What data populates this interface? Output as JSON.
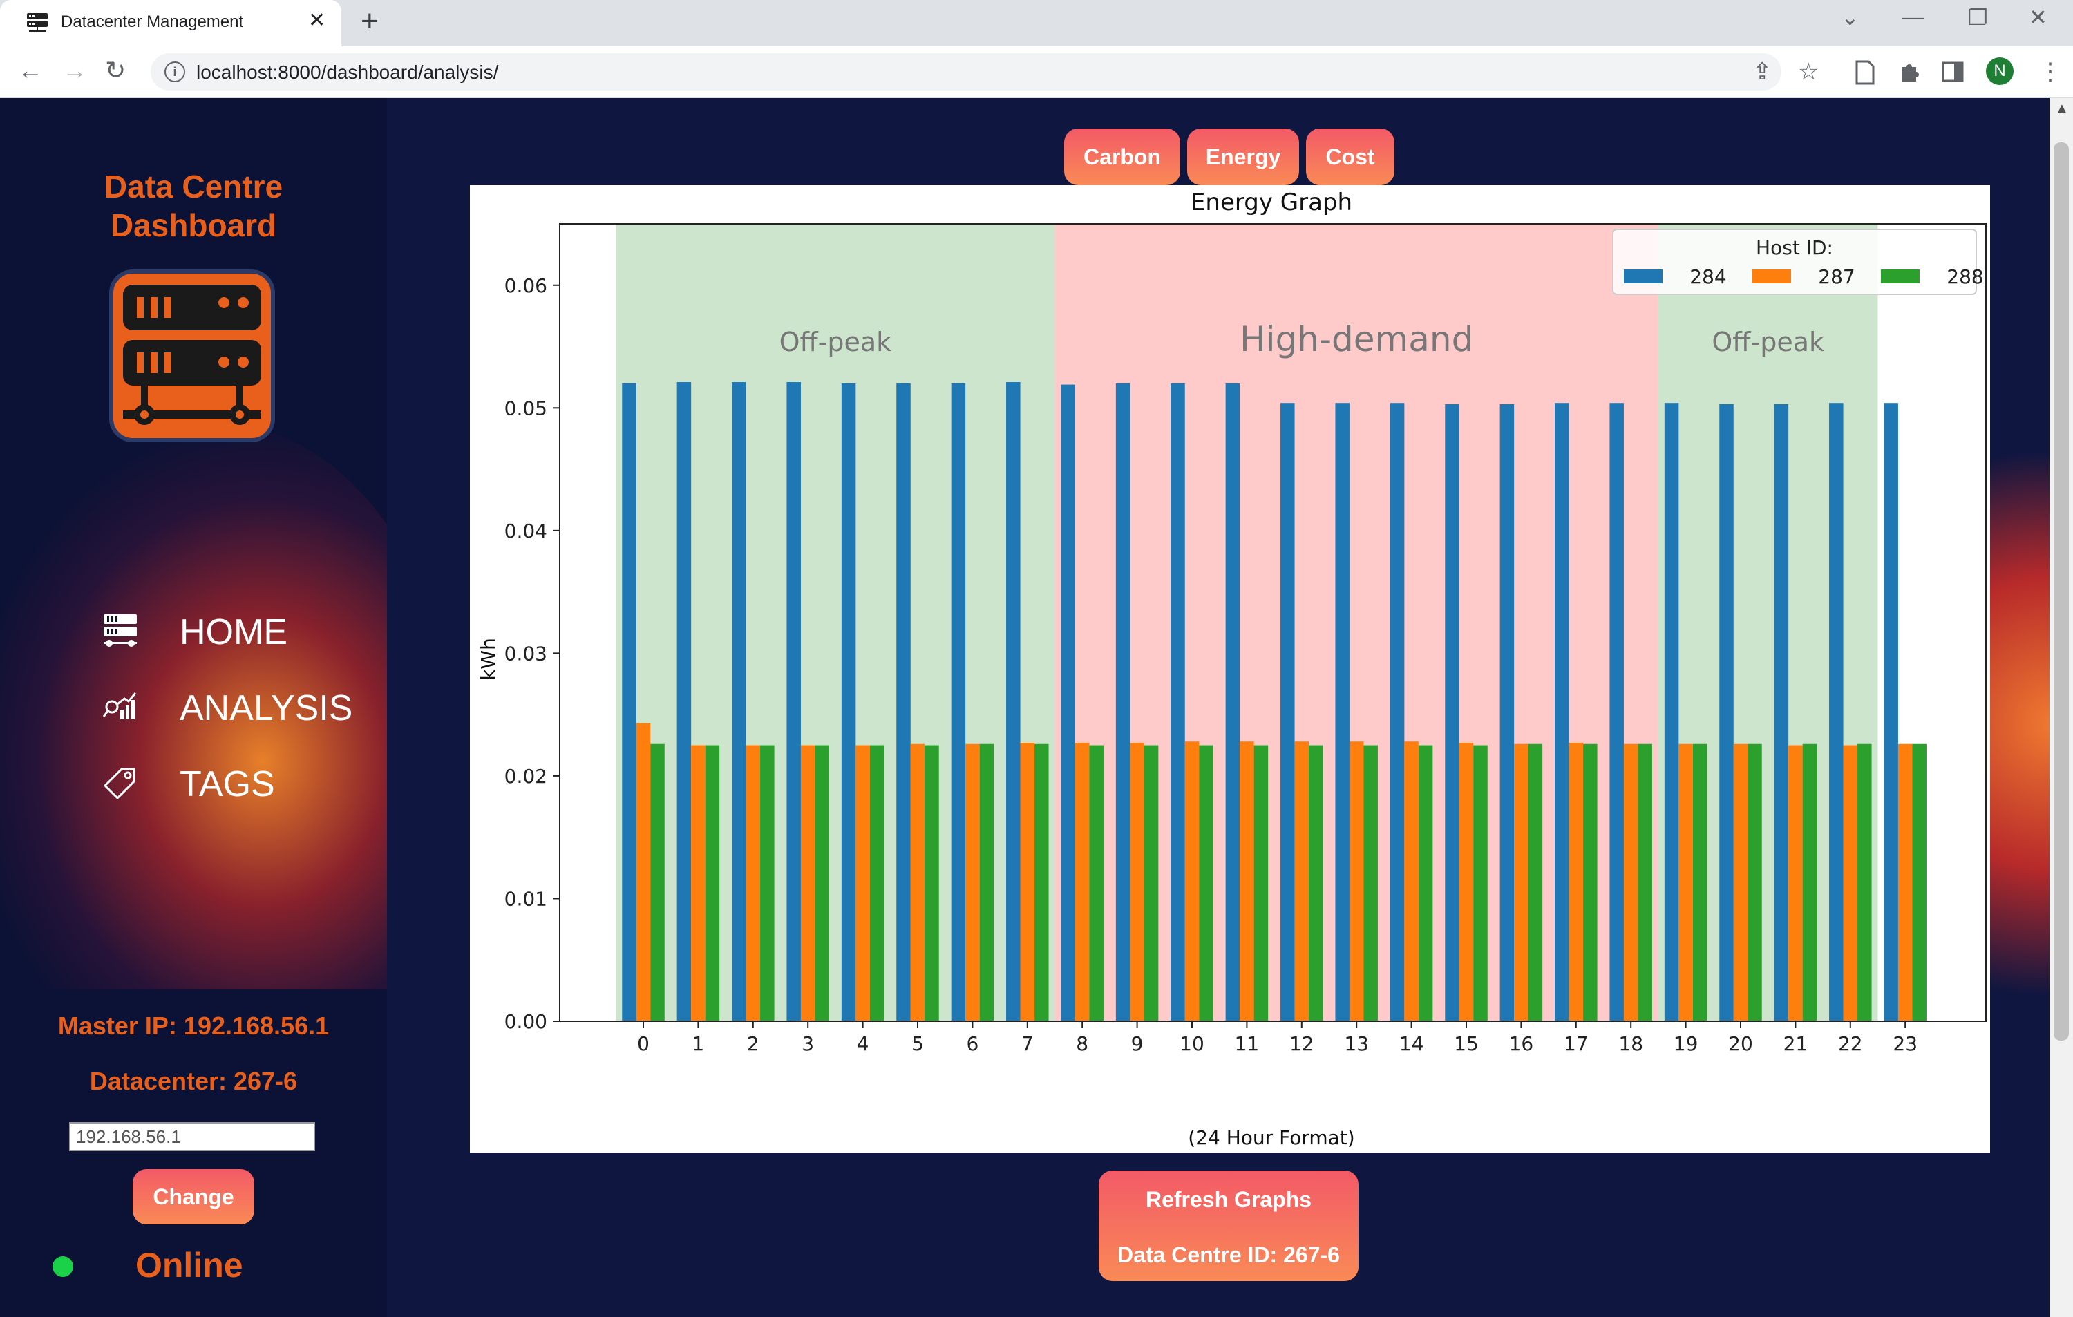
{
  "browser": {
    "tab_title": "Datacenter Management",
    "tab_close": "✕",
    "new_tab": "+",
    "url": "localhost:8000/dashboard/analysis/",
    "avatar_initial": "N",
    "controls": {
      "back": "←",
      "forward": "→",
      "reload": "↻",
      "share": "⇪",
      "bookmark": "☆",
      "minimize": "—",
      "restore": "❐",
      "close": "✕",
      "tab_search": "⌄",
      "menu": "⋮"
    }
  },
  "sidebar": {
    "brand_line1": "Data Centre",
    "brand_line2": "Dashboard",
    "nav": [
      {
        "label": "HOME",
        "icon": "server-icon"
      },
      {
        "label": "ANALYSIS",
        "icon": "analytics-icon"
      },
      {
        "label": "TAGS",
        "icon": "tag-icon"
      }
    ],
    "master_ip": "Master IP: 192.168.56.1",
    "datacenter": "Datacenter: 267-6",
    "ip_input_value": "192.168.56.1",
    "change_button": "Change",
    "status": "Online",
    "status_color": "#1bd14a",
    "accent_color": "#e8601c"
  },
  "graph_tabs": {
    "carbon": "Carbon",
    "energy": "Energy",
    "cost": "Cost"
  },
  "refresh": {
    "label": "Refresh Graphs",
    "dc_id": "Data Centre ID: 267-6"
  },
  "chart_data": {
    "type": "bar",
    "title": "Energy Graph",
    "xlabel": "(24 Hour Format)",
    "ylabel": "kWh",
    "ylim": [
      0,
      0.065
    ],
    "yticks": [
      "0.00",
      "0.01",
      "0.02",
      "0.03",
      "0.04",
      "0.05",
      "0.06"
    ],
    "categories": [
      "0",
      "1",
      "2",
      "3",
      "4",
      "5",
      "6",
      "7",
      "8",
      "9",
      "10",
      "11",
      "12",
      "13",
      "14",
      "15",
      "16",
      "17",
      "18",
      "19",
      "20",
      "21",
      "22",
      "23"
    ],
    "legend_title": "Host ID:",
    "legend_position": "top-right",
    "series": [
      {
        "name": "284",
        "color": "#1f77b4",
        "values": [
          0.052,
          0.0521,
          0.0521,
          0.0521,
          0.052,
          0.052,
          0.052,
          0.0521,
          0.0519,
          0.052,
          0.052,
          0.052,
          0.0504,
          0.0504,
          0.0504,
          0.0503,
          0.0503,
          0.0504,
          0.0504,
          0.0504,
          0.0503,
          0.0503,
          0.0504,
          0.0504
        ]
      },
      {
        "name": "287",
        "color": "#ff7f0e",
        "values": [
          0.0243,
          0.0225,
          0.0225,
          0.0225,
          0.0225,
          0.0226,
          0.0226,
          0.0227,
          0.0227,
          0.0227,
          0.0228,
          0.0228,
          0.0228,
          0.0228,
          0.0228,
          0.0227,
          0.0226,
          0.0227,
          0.0226,
          0.0226,
          0.0226,
          0.0225,
          0.0225,
          0.0226
        ]
      },
      {
        "name": "288",
        "color": "#2ca02c",
        "values": [
          0.0226,
          0.0225,
          0.0225,
          0.0225,
          0.0225,
          0.0225,
          0.0226,
          0.0226,
          0.0225,
          0.0225,
          0.0225,
          0.0225,
          0.0225,
          0.0225,
          0.0225,
          0.0225,
          0.0226,
          0.0226,
          0.0226,
          0.0226,
          0.0226,
          0.0226,
          0.0226,
          0.0226
        ]
      }
    ],
    "regions": [
      {
        "label": "Off-peak",
        "from": 0,
        "to": 7.5,
        "color": "#cde5cd"
      },
      {
        "label": "High-demand",
        "from": 7.5,
        "to": 18.5,
        "color": "#ffcaca"
      },
      {
        "label": "Off-peak",
        "from": 18.5,
        "to": 22.5,
        "color": "#cde5cd"
      }
    ]
  }
}
